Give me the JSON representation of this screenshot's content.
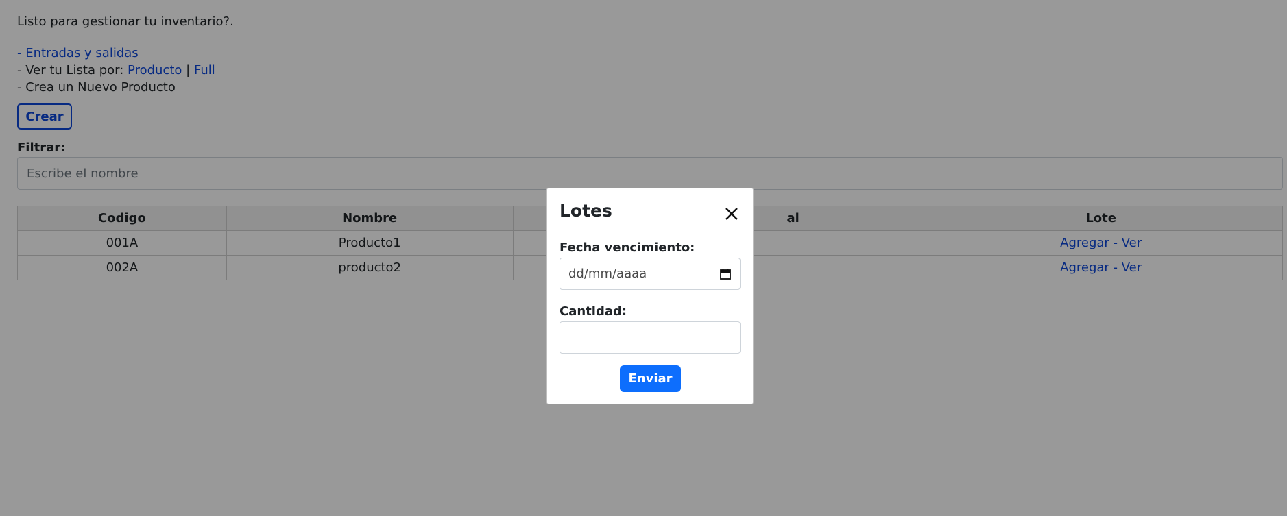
{
  "intro": "Listo para gestionar tu inventario?.",
  "menu": {
    "entradas_link": "- Entradas y salidas",
    "ver_prefix": "- Ver tu Lista por: ",
    "producto_link": "Producto",
    "separator": "|",
    "full_link": "Full",
    "nuevo_text": "- Crea un Nuevo Producto"
  },
  "crear_label": "Crear",
  "filter": {
    "label": "Filtrar:",
    "placeholder": "Escribe el nombre",
    "value": ""
  },
  "table": {
    "headers": [
      "Codigo",
      "Nombre",
      "",
      "al",
      "Lote"
    ],
    "rows": [
      {
        "codigo": "001A",
        "nombre": "Producto1",
        "lote_link": "Agregar - Ver"
      },
      {
        "codigo": "002A",
        "nombre": "producto2",
        "lote_link": "Agregar - Ver"
      }
    ]
  },
  "modal": {
    "title": "Lotes",
    "fecha_label": "Fecha vencimiento:",
    "fecha_placeholder": "dd/mm/aaaa",
    "cantidad_label": "Cantidad:",
    "cantidad_value": "",
    "submit_label": "Enviar"
  },
  "icons": {
    "close": "close-icon",
    "calendar": "calendar-icon"
  },
  "colors": {
    "link": "#0d47d9",
    "primary": "#0d6efd",
    "overlay": "rgba(0,0,0,0.4)"
  }
}
